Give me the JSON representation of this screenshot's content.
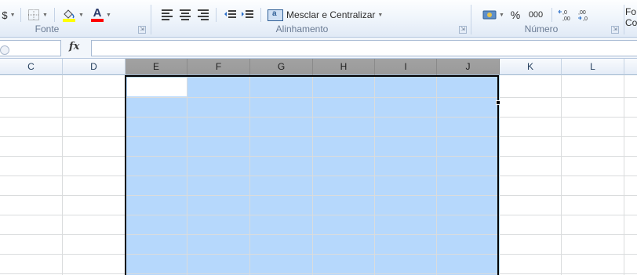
{
  "ribbon": {
    "fonte_group": {
      "label": "Fonte",
      "font_color_letter": "A",
      "fill_color": "#ffff00",
      "font_color": "#ff0000"
    },
    "alinhamento_group": {
      "label": "Alinhamento",
      "merge_label": "Mesclar e Centralizar"
    },
    "numero_group": {
      "label": "Número",
      "percent": "%",
      "thousands": "000",
      "increase_decimal": "←,0 ,00",
      "decrease_decimal": ",00 →,0"
    },
    "cut_left_glyph": "$",
    "cut_right_label_1": "Fo",
    "cut_right_label_2": "Co",
    "launcher_glyph": "⇲"
  },
  "formula_bar": {
    "fx_label": "fx",
    "value": ""
  },
  "grid": {
    "columns": [
      "C",
      "D",
      "E",
      "F",
      "G",
      "H",
      "I",
      "J",
      "K",
      "L"
    ],
    "selected_columns": [
      "E",
      "F",
      "G",
      "H",
      "I",
      "J"
    ],
    "selection_color": "#b6d8fc",
    "header_selected_color": "#9e9e9e"
  }
}
